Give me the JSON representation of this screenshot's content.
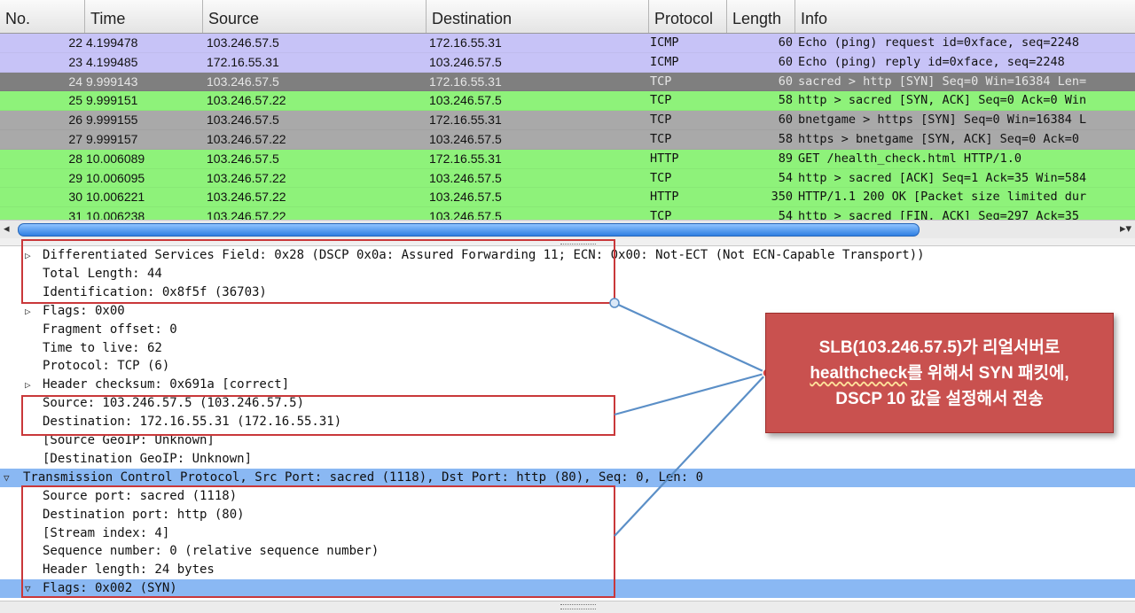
{
  "columns": [
    "No.",
    "Time",
    "Source",
    "Destination",
    "Protocol",
    "Length",
    "Info"
  ],
  "packets": [
    {
      "no": "22",
      "time": "4.199478",
      "src": "103.246.57.5",
      "dst": "172.16.55.31",
      "proto": "ICMP",
      "len": "60",
      "info": "Echo (ping) request  id=0xface, seq=2248",
      "bg": "#c7c3f7",
      "fg": "#111111"
    },
    {
      "no": "23",
      "time": "4.199485",
      "src": "172.16.55.31",
      "dst": "103.246.57.5",
      "proto": "ICMP",
      "len": "60",
      "info": "Echo (ping) reply    id=0xface, seq=2248",
      "bg": "#c7c3f7",
      "fg": "#111111"
    },
    {
      "no": "24",
      "time": "9.999143",
      "src": "103.246.57.5",
      "dst": "172.16.55.31",
      "proto": "TCP",
      "len": "60",
      "info": "sacred > http [SYN] Seq=0 Win=16384 Len=",
      "bg": "#7f7f7f",
      "fg": "#e6e6e6"
    },
    {
      "no": "25",
      "time": "9.999151",
      "src": "103.246.57.22",
      "dst": "103.246.57.5",
      "proto": "TCP",
      "len": "58",
      "info": "http > sacred [SYN, ACK] Seq=0 Ack=0 Win",
      "bg": "#8ef27a",
      "fg": "#111111"
    },
    {
      "no": "26",
      "time": "9.999155",
      "src": "103.246.57.5",
      "dst": "172.16.55.31",
      "proto": "TCP",
      "len": "60",
      "info": "bnetgame > https [SYN] Seq=0 Win=16384 L",
      "bg": "#a9a9a9",
      "fg": "#111111"
    },
    {
      "no": "27",
      "time": "9.999157",
      "src": "103.246.57.22",
      "dst": "103.246.57.5",
      "proto": "TCP",
      "len": "58",
      "info": "https > bnetgame [SYN, ACK] Seq=0 Ack=0 ",
      "bg": "#a9a9a9",
      "fg": "#111111"
    },
    {
      "no": "28",
      "time": "10.006089",
      "src": "103.246.57.5",
      "dst": "172.16.55.31",
      "proto": "HTTP",
      "len": "89",
      "info": "GET /health_check.html HTTP/1.0",
      "bg": "#8ef27a",
      "fg": "#111111"
    },
    {
      "no": "29",
      "time": "10.006095",
      "src": "103.246.57.22",
      "dst": "103.246.57.5",
      "proto": "TCP",
      "len": "54",
      "info": "http > sacred [ACK] Seq=1 Ack=35 Win=584",
      "bg": "#8ef27a",
      "fg": "#111111"
    },
    {
      "no": "30",
      "time": "10.006221",
      "src": "103.246.57.22",
      "dst": "103.246.57.5",
      "proto": "HTTP",
      "len": "350",
      "info": "HTTP/1.1 200 OK [Packet size limited dur",
      "bg": "#8ef27a",
      "fg": "#111111"
    },
    {
      "no": "31",
      "time": "10.006238",
      "src": "103.246.57.22",
      "dst": "103.246.57.5",
      "proto": "TCP",
      "len": "54",
      "info": "http > sacred [FIN, ACK] Seq=297 Ack=35 ",
      "bg": "#8ef27a",
      "fg": "#111111"
    }
  ],
  "scroll": {
    "left_arrow": "◂",
    "right_arrow": "▸▾"
  },
  "details": [
    {
      "indent": 0,
      "expander": "▷",
      "text": "Differentiated Services Field: 0x28 (DSCP 0x0a: Assured Forwarding 11; ECN: 0x00: Not-ECT (Not ECN-Capable Transport))"
    },
    {
      "indent": 1,
      "expander": "",
      "text": "Total Length: 44"
    },
    {
      "indent": 1,
      "expander": "",
      "text": "Identification: 0x8f5f (36703)"
    },
    {
      "indent": 0,
      "expander": "▷",
      "text": "Flags: 0x00"
    },
    {
      "indent": 1,
      "expander": "",
      "text": "Fragment offset: 0"
    },
    {
      "indent": 1,
      "expander": "",
      "text": "Time to live: 62"
    },
    {
      "indent": 1,
      "expander": "",
      "text": "Protocol: TCP (6)"
    },
    {
      "indent": 0,
      "expander": "▷",
      "text": "Header checksum: 0x691a [correct]"
    },
    {
      "indent": 1,
      "expander": "",
      "text": "Source: 103.246.57.5 (103.246.57.5)"
    },
    {
      "indent": 1,
      "expander": "",
      "text": "Destination: 172.16.55.31 (172.16.55.31)"
    },
    {
      "indent": 1,
      "expander": "",
      "text": "[Source GeoIP: Unknown]"
    },
    {
      "indent": 1,
      "expander": "",
      "text": "[Destination GeoIP: Unknown]"
    },
    {
      "indent": -1,
      "expander": "▽",
      "text": "Transmission Control Protocol, Src Port: sacred (1118), Dst Port: http (80), Seq: 0, Len: 0",
      "selected": true
    },
    {
      "indent": 1,
      "expander": "",
      "text": "Source port: sacred (1118)"
    },
    {
      "indent": 1,
      "expander": "",
      "text": "Destination port: http (80)"
    },
    {
      "indent": 1,
      "expander": "",
      "text": "[Stream index: 4]"
    },
    {
      "indent": 1,
      "expander": "",
      "text": "Sequence number: 0    (relative sequence number)"
    },
    {
      "indent": 1,
      "expander": "",
      "text": "Header length: 24 bytes"
    },
    {
      "indent": 0,
      "expander": "▽",
      "text": "Flags: 0x002 (SYN)",
      "selected": true
    }
  ],
  "callout": {
    "line1": "SLB(103.246.57.5)가 리얼서버로",
    "line2_prefix": "healthcheck",
    "line2_rest": "를 위해서 SYN 패킷에,",
    "line3": "DSCP 10 값을 설정해서 전송"
  },
  "colors": {
    "highlight": "#8ab8f3",
    "annotation_red": "#c9383a",
    "callout_bg": "#c9514f",
    "connector": "#5b8fc7"
  }
}
